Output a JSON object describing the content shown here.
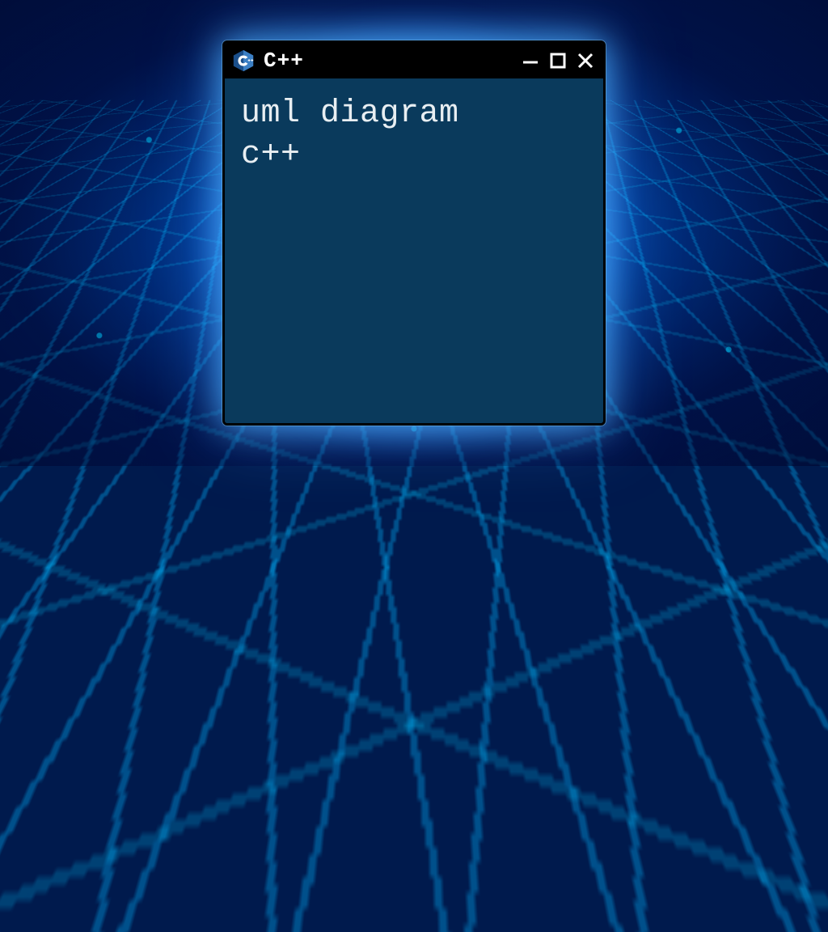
{
  "window": {
    "title": "C++",
    "icon": "cpp-logo-icon",
    "controls": {
      "minimize": "minimize",
      "maximize": "maximize",
      "close": "close"
    }
  },
  "content": {
    "text": "uml diagram\nc++"
  },
  "colors": {
    "window_bg": "#0a3a5c",
    "titlebar_bg": "#000000",
    "text": "#e8eef2",
    "glow": "#4fb4ff"
  }
}
